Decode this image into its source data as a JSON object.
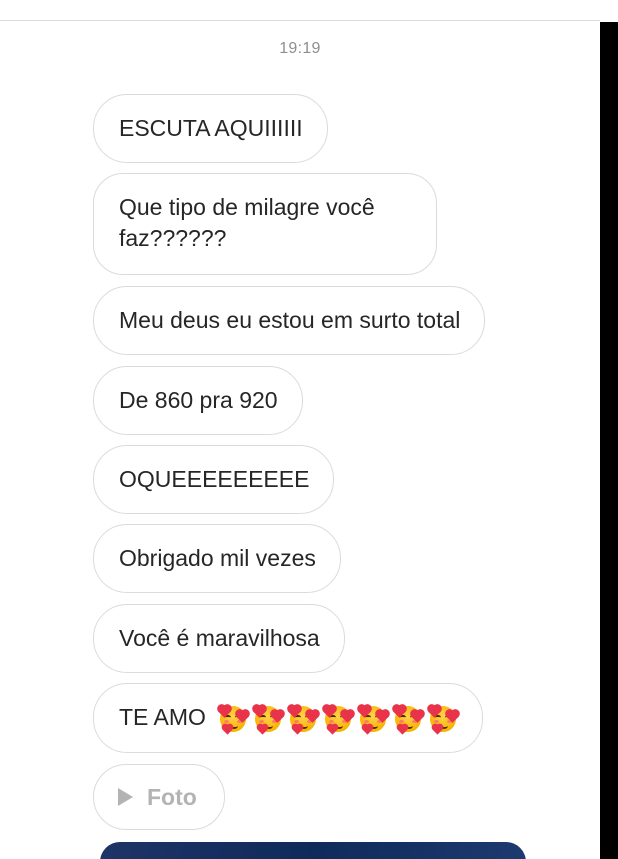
{
  "timestamp": "19:19",
  "messages": [
    {
      "text": "ESCUTA AQUIIIIII"
    },
    {
      "text": "Que tipo de milagre você faz??????"
    },
    {
      "text": "Meu deus eu estou em surto total"
    },
    {
      "text": "De 860 pra 920"
    },
    {
      "text": "OQUEEEEEEEEE"
    },
    {
      "text": "Obrigado mil vezes"
    },
    {
      "text": "Você é maravilhosa"
    },
    {
      "text": "TE AMO",
      "emojis": [
        "smiling-face-with-hearts-emoji",
        "smiling-face-with-hearts-emoji",
        "smiling-face-with-hearts-emoji",
        "smiling-face-with-hearts-emoji",
        "smiling-face-with-hearts-emoji",
        "smiling-face-with-hearts-emoji",
        "smiling-face-with-hearts-emoji"
      ]
    }
  ],
  "attachment": {
    "label": "Foto",
    "icon": "play-icon"
  },
  "colors": {
    "bubble_border": "#dbdbdb",
    "text": "#262626",
    "timestamp": "#8e8e8e",
    "foto_text": "#b3b3b3"
  }
}
